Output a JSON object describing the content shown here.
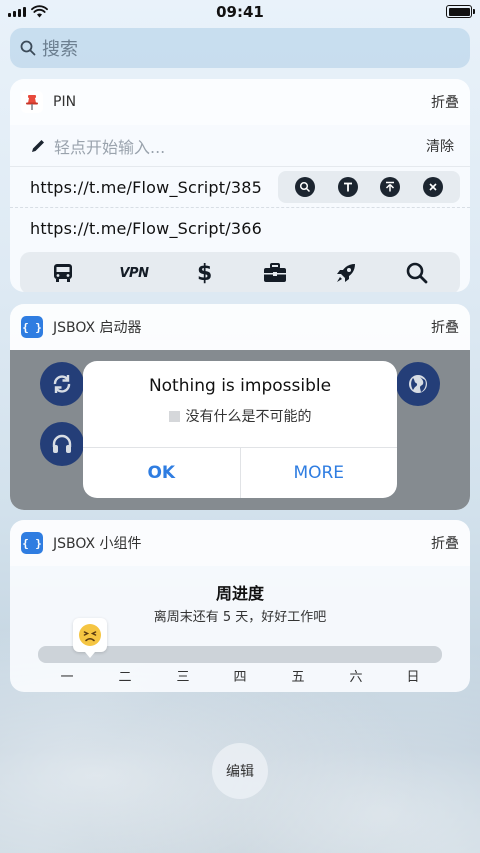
{
  "status": {
    "time": "09:41"
  },
  "search": {
    "placeholder": "搜索"
  },
  "pin": {
    "title": "PIN",
    "fold": "折叠",
    "input_placeholder": "轻点开始输入...",
    "clear": "清除",
    "items": [
      {
        "url": "https://t.me/Flow_Script/385"
      },
      {
        "url": "https://t.me/Flow_Script/366"
      }
    ],
    "actions": [
      "search-icon",
      "text-icon",
      "pin-top-icon",
      "close-icon"
    ],
    "toolbar": {
      "items": [
        "bus-icon",
        "vpn-label",
        "dollar-icon",
        "toolbox-icon",
        "rocket-icon",
        "search-icon"
      ],
      "vpn": "VPN",
      "dollar": "$"
    }
  },
  "launcher": {
    "title": "JSBOX 启动器",
    "fold": "折叠",
    "icon_text": "{ }"
  },
  "dialog": {
    "title": "Nothing is impossible",
    "message": "没有什么是不可能的",
    "ok": "OK",
    "more": "MORE"
  },
  "widget": {
    "title": "JSBOX 小组件",
    "fold": "折叠",
    "icon_text": "{ }",
    "week_title": "周进度",
    "week_subtitle": "离周末还有 5 天，好好工作吧",
    "progress_fraction": 0.14,
    "days": [
      "一",
      "二",
      "三",
      "四",
      "五",
      "六",
      "日"
    ]
  },
  "edit": {
    "label": "编辑"
  },
  "colors": {
    "accent": "#2f7de1",
    "launcher_button": "#243e78"
  }
}
